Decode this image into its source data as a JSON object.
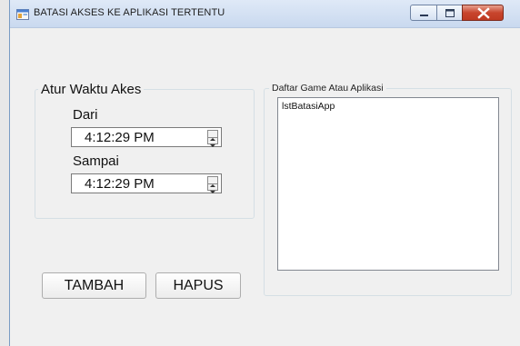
{
  "window": {
    "title": "BATASI AKSES KE APLIKASI TERTENTU",
    "icon": "form-icon",
    "controls": [
      "minimize-icon",
      "maximize-icon",
      "close-icon"
    ]
  },
  "time_group": {
    "legend": "Atur Waktu Akes",
    "from_label": "Dari",
    "from_value": "4:12:29 PM",
    "to_label": "Sampai",
    "to_value": "4:12:29 PM"
  },
  "list_group": {
    "legend": "Daftar Game Atau Aplikasi",
    "items": [
      "lstBatasiApp"
    ]
  },
  "buttons": {
    "add": "TAMBAH",
    "delete": "HAPUS"
  }
}
